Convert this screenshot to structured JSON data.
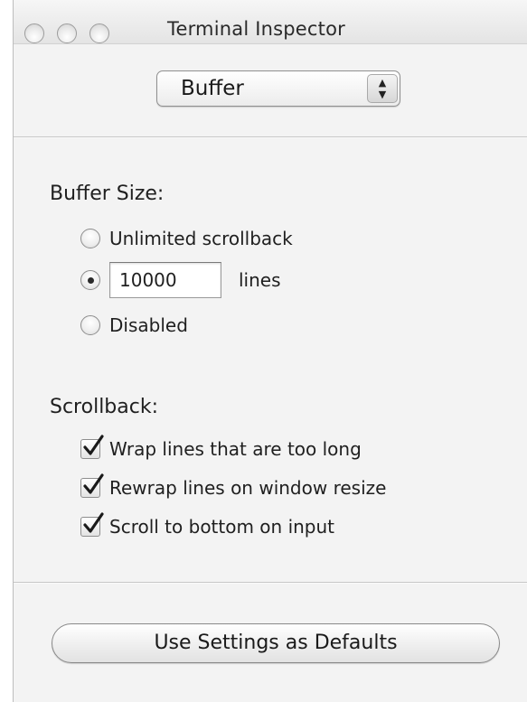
{
  "window": {
    "title": "Terminal Inspector"
  },
  "popup": {
    "selected": "Buffer"
  },
  "buffer_size": {
    "label": "Buffer Size:",
    "options": [
      {
        "label": "Unlimited scrollback",
        "selected": false
      },
      {
        "label": "lines",
        "selected": true,
        "value": "10000"
      },
      {
        "label": "Disabled",
        "selected": false
      }
    ]
  },
  "scrollback": {
    "label": "Scrollback:",
    "options": [
      {
        "label": "Wrap lines that are too long",
        "checked": true
      },
      {
        "label": "Rewrap lines on window resize",
        "checked": true
      },
      {
        "label": "Scroll to bottom on input",
        "checked": true
      }
    ]
  },
  "footer": {
    "defaults_button": "Use Settings as Defaults"
  },
  "icons": {
    "traffic_lights": [
      "close-icon",
      "minimize-icon",
      "zoom-icon"
    ],
    "popup_arrows": "up-down-arrows-icon",
    "checkmark": "checkmark-icon"
  }
}
